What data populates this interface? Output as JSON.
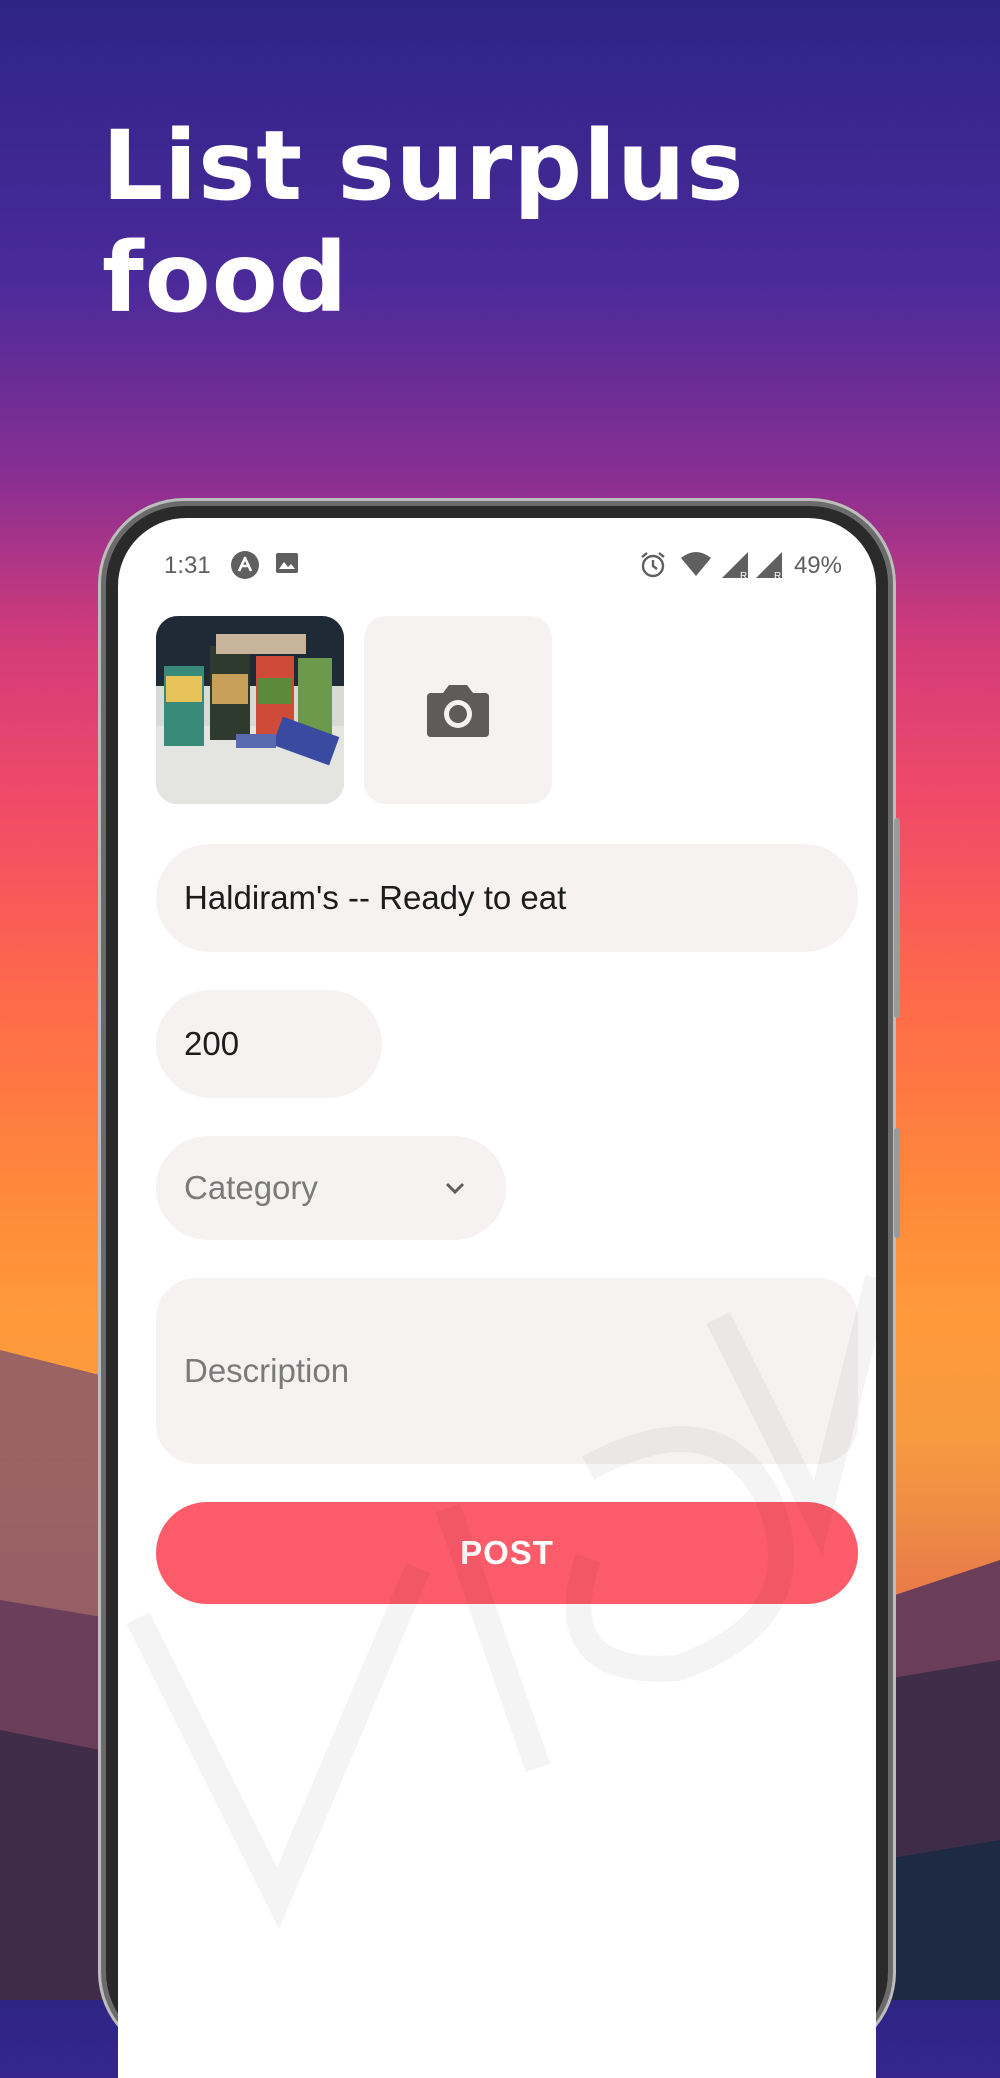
{
  "headline": "List surplus food",
  "status_bar": {
    "time": "1:31",
    "battery": "49%"
  },
  "form": {
    "item_name_value": "Haldiram's -- Ready to eat",
    "quantity_value": "200",
    "category_placeholder": "Category",
    "description_placeholder": "Description",
    "post_label": "POST"
  },
  "colors": {
    "accent": "#fc5b6a",
    "field_bg": "#f6f2f2"
  },
  "icons": [
    "app-logo-icon",
    "gallery-icon",
    "alarm-icon",
    "wifi-icon",
    "signal-icon",
    "camera-icon",
    "chevron-down-icon"
  ]
}
